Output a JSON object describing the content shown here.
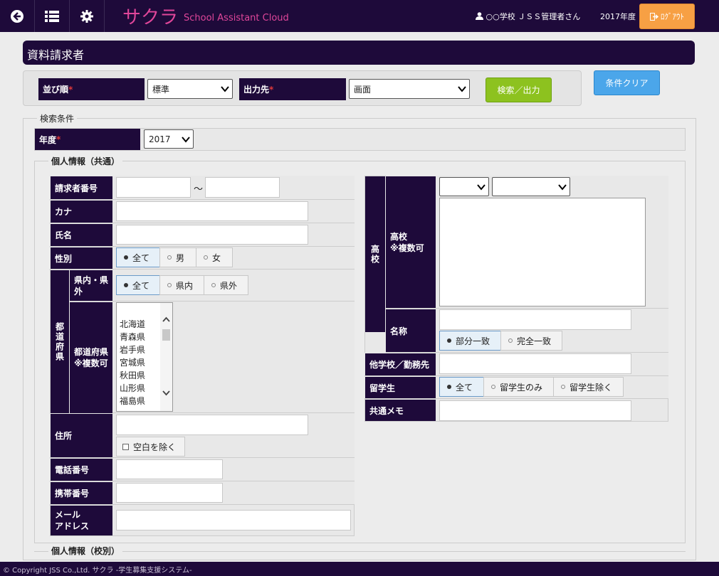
{
  "header": {
    "brand": "サクラ",
    "brand_sub": "School Assistant Cloud",
    "user": "○○学校 ＪＳＳ管理者さん",
    "year": "2017年度",
    "logout_label": "ﾛｸﾞｱｳﾄ",
    "icons": [
      "back-arrow-icon",
      "list-icon",
      "gear-icon",
      "user-icon",
      "logout-icon"
    ]
  },
  "page_title": "資料請求者",
  "controls": {
    "sort_label": "並び順",
    "sort_value": "標準",
    "output_label": "出力先",
    "output_value": "画面",
    "search_button": "検索／出力",
    "clear_button": "条件クリア",
    "required_mark": "*"
  },
  "search": {
    "legend": "検索条件",
    "year_label": "年度",
    "year_value": "2017"
  },
  "personal_common": {
    "legend": "個人情報（共通）",
    "requester_no_label": "請求者番号",
    "range_sep": "～",
    "kana_label": "カナ",
    "name_label": "氏名",
    "gender_label": "性別",
    "gender_options": [
      "全て",
      "男",
      "女"
    ],
    "pref_group_label": "都道府県",
    "inout_label": "県内・県外",
    "inout_options": [
      "全て",
      "県内",
      "県外"
    ],
    "pref_label_1": "都道府県",
    "pref_label_2": "※複数可",
    "prefectures": [
      "北海道",
      "青森県",
      "岩手県",
      "宮城県",
      "秋田県",
      "山形県",
      "福島県"
    ],
    "address_label": "住所",
    "exclude_blank": "空白を除く",
    "phone_label": "電話番号",
    "mobile_label": "携帯番号",
    "mail_label_1": "メール",
    "mail_label_2": "アドレス"
  },
  "school": {
    "group_label": "高校",
    "multi_label_1": "高校",
    "multi_label_2": "※複数可",
    "name_label": "名称",
    "match_options": [
      "部分一致",
      "完全一致"
    ],
    "other_school_label": "他学校／勤務先",
    "intl_label": "留学生",
    "intl_options": [
      "全て",
      "留学生のみ",
      "留学生除く"
    ],
    "memo_label": "共通メモ"
  },
  "personal_school": {
    "legend": "個人情報（校別）"
  },
  "footer": "© Copyright JSS Co.,Ltd. サクラ -学生募集支援システム-",
  "colors": {
    "header_bg": "#1e0a3a",
    "brand": "#e0469a",
    "logout": "#f7a044",
    "search_btn": "#8dc21f",
    "clear_btn": "#4ba6ea"
  }
}
